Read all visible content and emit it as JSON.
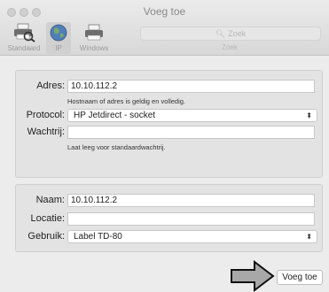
{
  "window": {
    "title": "Voeg toe"
  },
  "toolbar": {
    "items": [
      {
        "label": "Standaard",
        "icon": "default-printer-icon"
      },
      {
        "label": "IP",
        "icon": "ip-globe-icon",
        "selected": true
      },
      {
        "label": "Windows",
        "icon": "windows-printer-icon"
      }
    ],
    "search": {
      "placeholder": "Zoek",
      "label": "Zoek"
    }
  },
  "ip_section": {
    "address": {
      "label": "Adres:",
      "value": "10.10.112.2",
      "hint": "Hostnaam of adres is geldig en volledig."
    },
    "protocol": {
      "label": "Protocol:",
      "value": "HP Jetdirect - socket"
    },
    "queue": {
      "label": "Wachtrij:",
      "value": "",
      "hint": "Laat leeg voor standaardwachtrij."
    }
  },
  "printer_section": {
    "name": {
      "label": "Naam:",
      "value": "10.10.112.2"
    },
    "location": {
      "label": "Locatie:",
      "value": ""
    },
    "use": {
      "label": "Gebruik:",
      "value": "Label TD-80"
    }
  },
  "actions": {
    "add_label": "Voeg toe"
  },
  "colors": {
    "window_bg": "#ececec",
    "panel_bg": "#e3e3e3",
    "selected_tool_bg": "#d0d0d0",
    "annotation_arrow_fill": "#a8a8a8"
  }
}
